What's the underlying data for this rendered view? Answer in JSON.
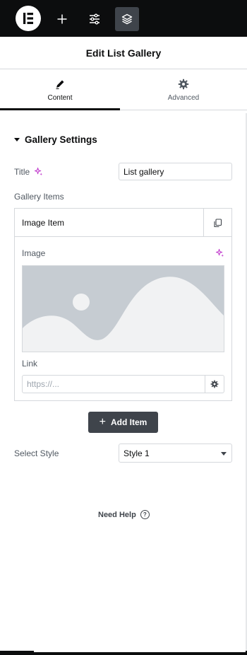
{
  "topbar": {
    "logo_icon": "elementor-logo-icon",
    "buttons": [
      {
        "icon": "plus-icon",
        "active": false
      },
      {
        "icon": "sliders-icon",
        "active": false
      },
      {
        "icon": "layers-icon",
        "active": true
      }
    ]
  },
  "header": {
    "title": "Edit List Gallery"
  },
  "tabs": [
    {
      "label": "Content",
      "icon": "pencil-icon",
      "active": true
    },
    {
      "label": "Advanced",
      "icon": "gear-icon",
      "active": false
    }
  ],
  "section": {
    "title": "Gallery Settings"
  },
  "fields": {
    "title_label": "Title",
    "title_value": "List gallery",
    "gallery_items_label": "Gallery Items"
  },
  "repeater": {
    "item_title": "Image Item",
    "image_label": "Image",
    "link_label": "Link",
    "link_placeholder": "https://..."
  },
  "add_item_label": "Add Item",
  "style": {
    "label": "Select Style",
    "selected": "Style 1"
  },
  "help_label": "Need Help",
  "colors": {
    "accent_ai": "#c039cc",
    "dark": "#0c0d0e",
    "button": "#3f444b",
    "border": "#d5d8dc",
    "placeholder_bg": "#c6ccd2"
  }
}
